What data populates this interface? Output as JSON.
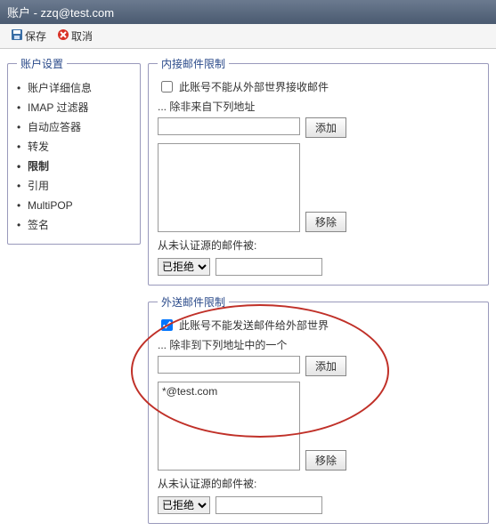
{
  "title": "账户 - zzq@test.com",
  "toolbar": {
    "save": "保存",
    "cancel": "取消"
  },
  "sidebar": {
    "legend": "账户设置",
    "items": [
      {
        "label": "账户详细信息"
      },
      {
        "label": "IMAP 过滤器"
      },
      {
        "label": "自动应答器"
      },
      {
        "label": "转发"
      },
      {
        "label": "限制"
      },
      {
        "label": "引用"
      },
      {
        "label": "MultiPOP"
      },
      {
        "label": "签名"
      }
    ],
    "active_index": 4
  },
  "incoming": {
    "legend": "内接邮件限制",
    "checkbox_label": "此账号不能从外部世界接收邮件",
    "checked": false,
    "except_label": "... 除非来自下列地址",
    "input_value": "",
    "add_btn": "添加",
    "remove_btn": "移除",
    "list_items": [],
    "unauth_label": "从未认证源的邮件被:",
    "unauth_value": "已拒绝",
    "unauth_extra": ""
  },
  "outgoing": {
    "legend": "外送邮件限制",
    "checkbox_label": "此账号不能发送邮件给外部世界",
    "checked": true,
    "except_label": "... 除非到下列地址中的一个",
    "input_value": "",
    "add_btn": "添加",
    "remove_btn": "移除",
    "list_items": [
      "*@test.com"
    ],
    "unauth_label": "从未认证源的邮件被:",
    "unauth_value": "已拒绝",
    "unauth_extra": ""
  }
}
